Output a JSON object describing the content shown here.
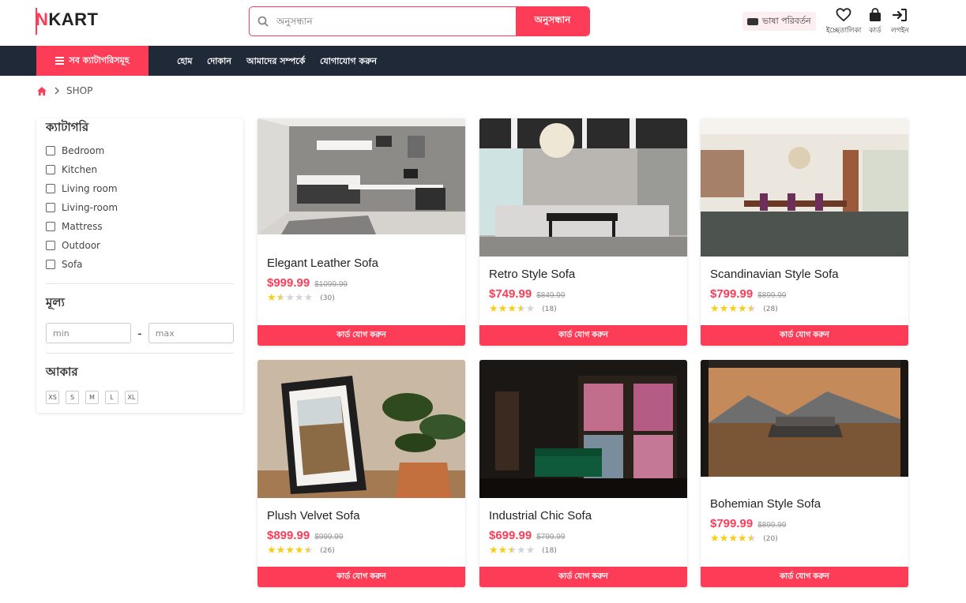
{
  "brand": {
    "logo_first": "N",
    "logo_rest": "KART"
  },
  "search": {
    "placeholder": "অনুসন্ধান",
    "button": "অনুসন্ধান"
  },
  "header_actions": {
    "language": "ভাষা পরিবর্তন",
    "wishlist": "ইচ্ছেতালিকা",
    "cart": "কার্ড",
    "login": "লগইন"
  },
  "nav": {
    "all_categories": "সব ক্যাটাগরিসমূহ",
    "links": [
      "হোম",
      "দোকান",
      "আমাদের সম্পর্কে",
      "যোগাযোগ করুন"
    ]
  },
  "breadcrumb": {
    "current": "SHOP"
  },
  "filters": {
    "category_title": "ক্যাটাগরি",
    "categories": [
      "Bedroom",
      "Kitchen",
      "Living room",
      "Living-room",
      "Mattress",
      "Outdoor",
      "Sofa"
    ],
    "price_title": "মূল্য",
    "min_placeholder": "min",
    "max_placeholder": "max",
    "price_separator": "-",
    "size_title": "আকার",
    "sizes": [
      "XS",
      "S",
      "M",
      "L",
      "XL"
    ]
  },
  "products": [
    {
      "name": "Elegant Leather Sofa",
      "price": "$999.99",
      "old_price": "$1099.99",
      "rating": 1.5,
      "reviews": "(30)",
      "add_label": "কার্ড যোগ করুন"
    },
    {
      "name": "Retro Style Sofa",
      "price": "$749.99",
      "old_price": "$849.99",
      "rating": 3.5,
      "reviews": "(18)",
      "add_label": "কার্ড যোগ করুন"
    },
    {
      "name": "Scandinavian Style Sofa",
      "price": "$799.99",
      "old_price": "$899.99",
      "rating": 4.5,
      "reviews": "(28)",
      "add_label": "কার্ড যোগ করুন"
    },
    {
      "name": "Plush Velvet Sofa",
      "price": "$899.99",
      "old_price": "$999.99",
      "rating": 4.5,
      "reviews": "(26)",
      "add_label": "কার্ড যোগ করুন"
    },
    {
      "name": "Industrial Chic Sofa",
      "price": "$699.99",
      "old_price": "$799.99",
      "rating": 2.5,
      "reviews": "(18)",
      "add_label": "কার্ড যোগ করুন"
    },
    {
      "name": "Bohemian Style Sofa",
      "price": "$799.99",
      "old_price": "$899.99",
      "rating": 4.5,
      "reviews": "(20)",
      "add_label": "কার্ড যোগ করুন"
    }
  ],
  "colors": {
    "accent": "#fd3d57",
    "nav_bg": "#1f2937",
    "star": "#facc15"
  }
}
